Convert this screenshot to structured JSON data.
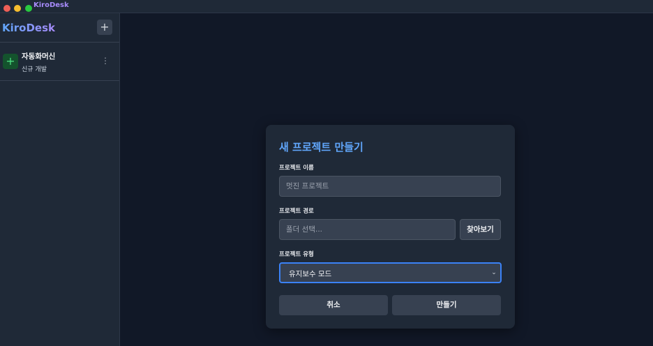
{
  "window": {
    "title": "KiroDesk"
  },
  "sidebar": {
    "brand": "KiroDesk",
    "add_button_label": "+",
    "projects": [
      {
        "icon": "+",
        "name": "자동화머신",
        "subtitle": "신규 개발",
        "menu_icon": "⋮"
      }
    ]
  },
  "modal": {
    "title": "새 프로젝트 만들기",
    "name_label": "프로젝트 이름",
    "name_placeholder": "멋진 프로젝트",
    "path_label": "프로젝트 경로",
    "path_placeholder": "폴더 선택...",
    "browse_label": "찾아보기",
    "type_label": "프로젝트 유형",
    "type_selected": "유지보수 모드",
    "cancel_label": "취소",
    "create_label": "만들기"
  },
  "colors": {
    "background": "#111827",
    "panel": "#1f2937",
    "accent_blue": "#60a5fa",
    "accent_purple": "#a78bfa",
    "focus_border": "#3b82f6"
  }
}
